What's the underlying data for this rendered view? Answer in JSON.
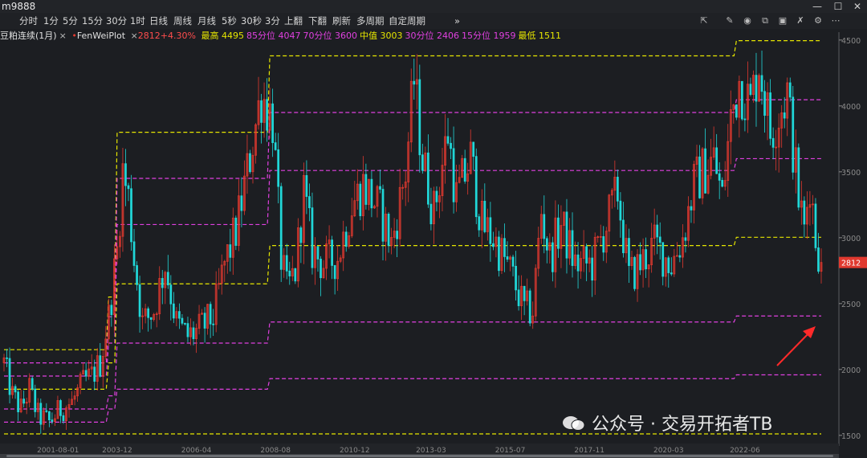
{
  "window": {
    "title": "m9888"
  },
  "toolbar": {
    "periods": [
      "分时",
      "1分",
      "5分",
      "15分",
      "30分",
      "1时",
      "日线",
      "周线",
      "月线",
      "5秒",
      "30秒",
      "3分",
      "上翻",
      "下翻",
      "刷新",
      "多周期",
      "自定周期"
    ],
    "more": "»",
    "right_icons": [
      "expand-icon",
      "pencil-icon",
      "eye-icon",
      "layers-icon",
      "image-icon",
      "trash-icon",
      "gear-icon",
      "more-icon"
    ]
  },
  "legend": {
    "symbol": "豆粕连续(1月)",
    "close_mark": "×",
    "indicator": "FenWeiPlot",
    "close_mark2": "×",
    "price_change": "2812+4.30%",
    "stats": [
      {
        "label": "最高 4495",
        "color": "#e6e600"
      },
      {
        "label": "85分位 4047",
        "color": "#e040e0"
      },
      {
        "label": "70分位 3600",
        "color": "#e040e0"
      },
      {
        "label": "中值 3003",
        "color": "#e6e600"
      },
      {
        "label": "30分位 2406",
        "color": "#e040e0"
      },
      {
        "label": "15分位 1959",
        "color": "#e040e0"
      },
      {
        "label": "最低 1511",
        "color": "#e6e600"
      }
    ]
  },
  "watermark": "公众号 · 交易开拓者TB",
  "colors": {
    "up": "#e0392f",
    "down": "#21d7d8",
    "bg": "#1c1e22",
    "yellow": "#e6e600",
    "magenta": "#e040e0",
    "axis": "#8a8a8a"
  },
  "chart_data": {
    "type": "candlestick",
    "frequency": "monthly",
    "title": "豆粕连续(1月)",
    "ylim": [
      1450,
      4560
    ],
    "y_ticks": [
      1500,
      2000,
      2500,
      3000,
      3500,
      4000,
      4500
    ],
    "current_price": 2812,
    "x_range": [
      "2000-08",
      "2024-09"
    ],
    "x_labels": [
      {
        "date": "2001-08",
        "label": "2001-08-01"
      },
      {
        "date": "2003-12",
        "label": "2003-12"
      },
      {
        "date": "2006-04",
        "label": "2006-04"
      },
      {
        "date": "2008-08",
        "label": "2008-08"
      },
      {
        "date": "2010-12",
        "label": "2010-12"
      },
      {
        "date": "2013-03",
        "label": "2013-03"
      },
      {
        "date": "2015-07",
        "label": "2015-07"
      },
      {
        "date": "2017-11",
        "label": "2017-11"
      },
      {
        "date": "2020-03",
        "label": "2020-03"
      },
      {
        "date": "2022-06",
        "label": "2022-06"
      }
    ],
    "price_anchors": [
      [
        "2000-08",
        2050
      ],
      [
        "2000-11",
        1800
      ],
      [
        "2001-02",
        1700
      ],
      [
        "2001-05",
        1850
      ],
      [
        "2001-08",
        1650
      ],
      [
        "2001-12",
        1600
      ],
      [
        "2002-04",
        1700
      ],
      [
        "2002-08",
        1750
      ],
      [
        "2002-12",
        1900
      ],
      [
        "2003-03",
        1950
      ],
      [
        "2003-06",
        2050
      ],
      [
        "2003-09",
        2400
      ],
      [
        "2003-12",
        2900
      ],
      [
        "2004-02",
        3500
      ],
      [
        "2004-04",
        3300
      ],
      [
        "2004-06",
        2850
      ],
      [
        "2004-09",
        2350
      ],
      [
        "2005-01",
        2450
      ],
      [
        "2005-05",
        2800
      ],
      [
        "2005-09",
        2350
      ],
      [
        "2006-01",
        2250
      ],
      [
        "2006-05",
        2300
      ],
      [
        "2006-10",
        2400
      ],
      [
        "2007-02",
        2800
      ],
      [
        "2007-06",
        3050
      ],
      [
        "2007-10",
        3500
      ],
      [
        "2008-03",
        4100
      ],
      [
        "2008-07",
        3900
      ],
      [
        "2008-10",
        2850
      ],
      [
        "2008-12",
        2600
      ],
      [
        "2009-03",
        2750
      ],
      [
        "2009-06",
        3350
      ],
      [
        "2009-09",
        2900
      ],
      [
        "2010-01",
        2800
      ],
      [
        "2010-06",
        2850
      ],
      [
        "2010-11",
        3250
      ],
      [
        "2011-03",
        3400
      ],
      [
        "2011-09",
        3200
      ],
      [
        "2012-01",
        2950
      ],
      [
        "2012-06",
        3500
      ],
      [
        "2012-09",
        4200
      ],
      [
        "2012-12",
        3600
      ],
      [
        "2013-04",
        3200
      ],
      [
        "2013-09",
        3800
      ],
      [
        "2013-12",
        3300
      ],
      [
        "2014-05",
        3600
      ],
      [
        "2014-09",
        3100
      ],
      [
        "2015-01",
        3000
      ],
      [
        "2015-07",
        2750
      ],
      [
        "2015-12",
        2450
      ],
      [
        "2016-03",
        2450
      ],
      [
        "2016-06",
        3200
      ],
      [
        "2016-09",
        2850
      ],
      [
        "2017-01",
        3100
      ],
      [
        "2017-06",
        2800
      ],
      [
        "2017-12",
        2800
      ],
      [
        "2018-05",
        3100
      ],
      [
        "2018-09",
        3350
      ],
      [
        "2019-01",
        2700
      ],
      [
        "2019-05",
        2800
      ],
      [
        "2019-10",
        2950
      ],
      [
        "2020-04",
        2800
      ],
      [
        "2020-08",
        3000
      ],
      [
        "2020-12",
        3400
      ],
      [
        "2021-03",
        3500
      ],
      [
        "2021-07",
        3600
      ],
      [
        "2021-10",
        3300
      ],
      [
        "2022-01",
        3900
      ],
      [
        "2022-04",
        4200
      ],
      [
        "2022-08",
        4000
      ],
      [
        "2022-11",
        4350
      ],
      [
        "2023-03",
        3800
      ],
      [
        "2023-06",
        3950
      ],
      [
        "2023-09",
        4100
      ],
      [
        "2024-01",
        3300
      ],
      [
        "2024-03",
        3050
      ],
      [
        "2024-05",
        3450
      ],
      [
        "2024-07",
        3000
      ],
      [
        "2024-09",
        2812
      ]
    ],
    "series": [
      {
        "name": "最高",
        "color": "#e6e600",
        "steps": [
          [
            "2000-08",
            2150
          ],
          [
            "2003-09",
            2550
          ],
          [
            "2003-12",
            3800
          ],
          [
            "2008-06",
            4380
          ],
          [
            "2022-03",
            4495
          ]
        ]
      },
      {
        "name": "85分位",
        "color": "#e040e0",
        "steps": [
          [
            "2000-08",
            2050
          ],
          [
            "2003-09",
            2400
          ],
          [
            "2003-12",
            3450
          ],
          [
            "2008-06",
            3950
          ],
          [
            "2022-03",
            4047
          ]
        ]
      },
      {
        "name": "70分位",
        "color": "#e040e0",
        "steps": [
          [
            "2000-08",
            1950
          ],
          [
            "2003-09",
            2200
          ],
          [
            "2003-12",
            3100
          ],
          [
            "2008-06",
            3510
          ],
          [
            "2022-03",
            3600
          ]
        ]
      },
      {
        "name": "中值",
        "color": "#e6e600",
        "steps": [
          [
            "2000-08",
            1850
          ],
          [
            "2003-09",
            2050
          ],
          [
            "2003-12",
            2650
          ],
          [
            "2008-06",
            2940
          ],
          [
            "2022-03",
            3003
          ]
        ]
      },
      {
        "name": "30分位",
        "color": "#e040e0",
        "steps": [
          [
            "2000-08",
            1700
          ],
          [
            "2003-09",
            1800
          ],
          [
            "2003-12",
            2200
          ],
          [
            "2008-06",
            2360
          ],
          [
            "2022-03",
            2406
          ]
        ]
      },
      {
        "name": "15分位",
        "color": "#e040e0",
        "steps": [
          [
            "2000-08",
            1600
          ],
          [
            "2003-09",
            1700
          ],
          [
            "2003-12",
            1850
          ],
          [
            "2008-06",
            1930
          ],
          [
            "2022-03",
            1959
          ]
        ]
      },
      {
        "name": "最低",
        "color": "#e6e600",
        "steps": [
          [
            "2000-08",
            1511
          ],
          [
            "2003-09",
            1511
          ],
          [
            "2003-12",
            1511
          ],
          [
            "2008-06",
            1511
          ],
          [
            "2022-03",
            1511
          ]
        ]
      }
    ]
  }
}
